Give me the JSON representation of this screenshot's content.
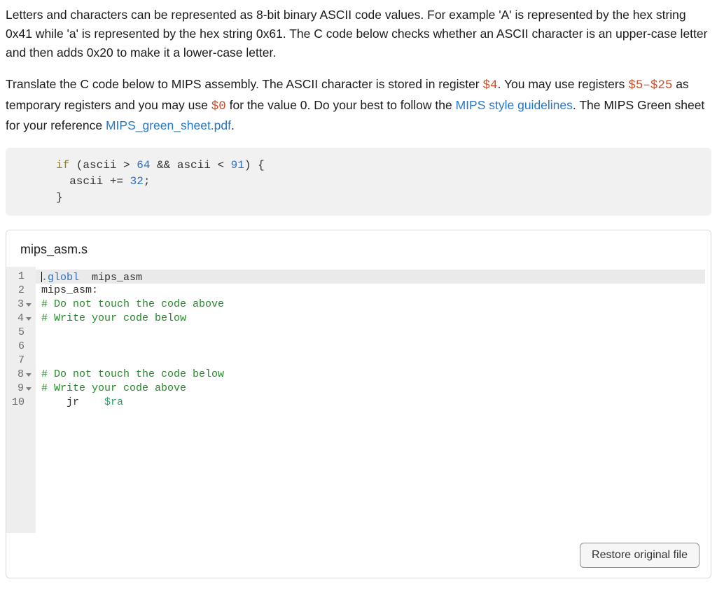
{
  "intro": {
    "p1_a": "Letters and characters can be represented as 8-bit binary ASCII code values. For example 'A' is represented by the hex string 0x41 while 'a' is represented by the hex string 0x61. The C code below checks whether an ASCII character is an upper-case letter and then adds 0x20 to make it a lower-case letter.",
    "p2_a": "Translate the C code below to MIPS assembly. The ASCII character is stored in register ",
    "reg4": "$4",
    "p2_b": ". You may use registers ",
    "reg5_25": "$5–$25",
    "p2_c": " as temporary registers and you may use ",
    "reg0": "$0",
    "p2_d": " for the value 0. Do your best to follow the ",
    "link1_text": "MIPS style guidelines",
    "p2_e": ". The MIPS Green sheet for your reference ",
    "link2_text": "MIPS_green_sheet.pdf",
    "p2_f": "."
  },
  "c_code": {
    "kw_if": "if",
    "open": " (ascii ",
    "gt": ">",
    "n64": " 64",
    "and": " && ",
    "ascii2": "ascii ",
    "lt": "<",
    "n91": " 91",
    "close": ") {",
    "line2a": "  ascii ",
    "pluseq": "+=",
    "n32": " 32",
    "semi": ";",
    "line3": "}"
  },
  "editor": {
    "filename": "mips_asm.s",
    "button": "Restore original file",
    "gutter": [
      "1",
      "2",
      "3",
      "4",
      "5",
      "6",
      "7",
      "8",
      "9",
      "10"
    ],
    "fold_lines": [
      3,
      4,
      8,
      9
    ],
    "lines": {
      "l1_dir": ".globl",
      "l1_rest": "  mips_asm",
      "l2": "mips_asm:",
      "l3": "# Do not touch the code above",
      "l4": "# Write your code below",
      "l8": "# Do not touch the code below",
      "l9": "# Write your code above",
      "l10_a": "    jr    ",
      "l10_reg": "$ra"
    }
  }
}
